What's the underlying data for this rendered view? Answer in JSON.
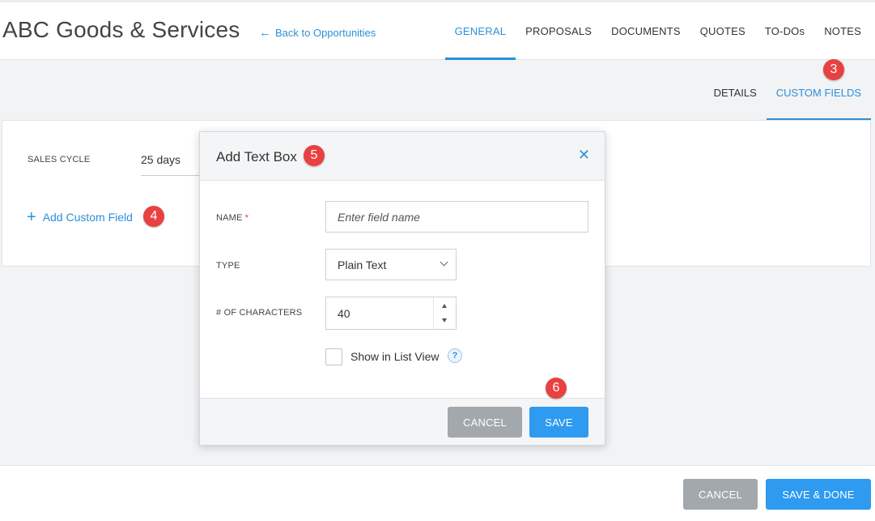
{
  "header": {
    "title": "ABC Goods & Services",
    "back_link": "Back to Opportunities",
    "tabs": [
      {
        "label": "GENERAL",
        "active": true
      },
      {
        "label": "PROPOSALS"
      },
      {
        "label": "DOCUMENTS"
      },
      {
        "label": "QUOTES"
      },
      {
        "label": "TO-DOs"
      },
      {
        "label": "NOTES"
      }
    ]
  },
  "subtabs": [
    {
      "label": "DETAILS"
    },
    {
      "label": "CUSTOM FIELDS",
      "active": true
    }
  ],
  "card": {
    "sales_cycle_label": "SALES CYCLE",
    "sales_cycle_value": "25 days",
    "add_custom_field": "Add Custom Field"
  },
  "modal": {
    "title": "Add Text Box",
    "name_label": "NAME",
    "required_mark": "*",
    "name_placeholder": "Enter field name",
    "type_label": "TYPE",
    "type_value": "Plain Text",
    "chars_label": "# OF CHARACTERS",
    "chars_value": "40",
    "show_in_list_label": "Show in List View",
    "help": "?",
    "cancel": "CANCEL",
    "save": "SAVE"
  },
  "footer": {
    "cancel": "CANCEL",
    "save_done": "SAVE & DONE"
  },
  "badges": {
    "b3": "3",
    "b4": "4",
    "b5": "5",
    "b6": "6"
  },
  "colors": {
    "accent": "#2e8fd8",
    "badge": "#e84141",
    "button_gray": "#a3a8ad",
    "button_blue": "#2e9af0"
  }
}
